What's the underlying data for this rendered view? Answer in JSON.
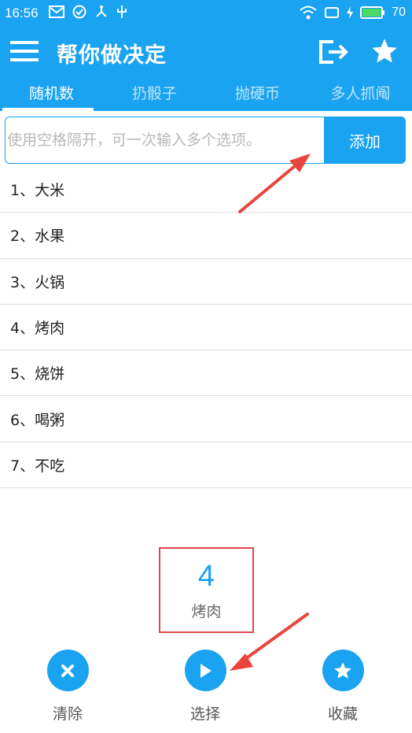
{
  "status_bar": {
    "time": "16:56",
    "battery": "70"
  },
  "app_bar": {
    "title": "帮你做决定"
  },
  "tabs": [
    {
      "label": "随机数",
      "active": true
    },
    {
      "label": "扔骰子",
      "active": false
    },
    {
      "label": "抛硬币",
      "active": false
    },
    {
      "label": "多人抓阄",
      "active": false
    }
  ],
  "input": {
    "placeholder": "使用空格隔开，可一次输入多个选项。",
    "value": "",
    "add_label": "添加"
  },
  "options": [
    {
      "label": "1、大米"
    },
    {
      "label": "2、水果"
    },
    {
      "label": "3、火锅"
    },
    {
      "label": "4、烤肉"
    },
    {
      "label": "5、烧饼"
    },
    {
      "label": "6、喝粥"
    },
    {
      "label": "7、不吃"
    }
  ],
  "result": {
    "number": "4",
    "text": "烤肉"
  },
  "actions": {
    "clear_label": "清除",
    "select_label": "选择",
    "favorite_label": "收藏"
  },
  "colors": {
    "accent": "#1aa3f0",
    "highlight": "#e0474c",
    "annotation_arrow": "#e8453c"
  }
}
